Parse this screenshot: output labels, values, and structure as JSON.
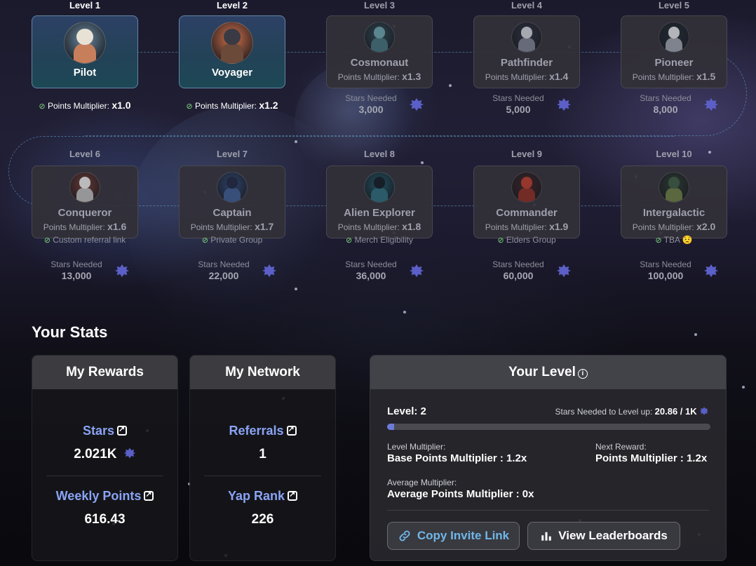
{
  "levels": [
    {
      "level_label": "Level 1",
      "name": "Pilot",
      "multiplier_label": "Points Multiplier:",
      "multiplier_value": "x1.0",
      "unlocked": true,
      "palette": {
        "bg": "#6b8aa0",
        "helmet": "#e8e2d6",
        "body": "#c77f5b"
      }
    },
    {
      "level_label": "Level 2",
      "name": "Voyager",
      "multiplier_label": "Points Multiplier:",
      "multiplier_value": "x1.2",
      "unlocked": true,
      "palette": {
        "bg": "#d7724a",
        "helmet": "#3a3a44",
        "body": "#6b4a3a"
      }
    },
    {
      "level_label": "Level 3",
      "name": "Cosmonaut",
      "multiplier_label": "Points Multiplier:",
      "multiplier_value": "x1.3",
      "unlocked": false,
      "stars_label": "Stars Needed",
      "stars_value": "3,000",
      "palette": {
        "bg": "#2a4a55",
        "helmet": "#6aa2ad",
        "body": "#40707a"
      }
    },
    {
      "level_label": "Level 4",
      "name": "Pathfinder",
      "multiplier_label": "Points Multiplier:",
      "multiplier_value": "x1.4",
      "unlocked": false,
      "stars_label": "Stars Needed",
      "stars_value": "5,000",
      "palette": {
        "bg": "#2a3240",
        "helmet": "#cfd3da",
        "body": "#7a8090"
      }
    },
    {
      "level_label": "Level 5",
      "name": "Pioneer",
      "multiplier_label": "Points Multiplier:",
      "multiplier_value": "x1.5",
      "unlocked": false,
      "stars_label": "Stars Needed",
      "stars_value": "8,000",
      "palette": {
        "bg": "#1e2a34",
        "helmet": "#e0e2e6",
        "body": "#9aa0aa"
      }
    },
    {
      "level_label": "Level 6",
      "name": "Conqueror",
      "multiplier_label": "Points Multiplier:",
      "multiplier_value": "x1.6",
      "perk": "Custom referral link",
      "unlocked": false,
      "stars_label": "Stars Needed",
      "stars_value": "13,000",
      "palette": {
        "bg": "#7a3a30",
        "helmet": "#e8e8e8",
        "body": "#b8b8b8"
      }
    },
    {
      "level_label": "Level 7",
      "name": "Captain",
      "multiplier_label": "Points Multiplier:",
      "multiplier_value": "x1.7",
      "perk": "Private Group",
      "unlocked": false,
      "stars_label": "Stars Needed",
      "stars_value": "22,000",
      "palette": {
        "bg": "#2c4a7a",
        "helmet": "#1a2440",
        "body": "#3a5a90"
      }
    },
    {
      "level_label": "Level 8",
      "name": "Alien Explorer",
      "multiplier_label": "Points Multiplier:",
      "multiplier_value": "x1.8",
      "perk": "Merch Eligibility",
      "unlocked": false,
      "stars_label": "Stars Needed",
      "stars_value": "36,000",
      "palette": {
        "bg": "#1a5a6a",
        "helmet": "#0e1a22",
        "body": "#2a6a7a"
      }
    },
    {
      "level_label": "Level 9",
      "name": "Commander",
      "multiplier_label": "Points Multiplier:",
      "multiplier_value": "x1.9",
      "perk": "Elders Group",
      "unlocked": false,
      "stars_label": "Stars Needed",
      "stars_value": "60,000",
      "palette": {
        "bg": "#3a2020",
        "helmet": "#b83a2a",
        "body": "#8a2a20"
      }
    },
    {
      "level_label": "Level 10",
      "name": "Intergalactic",
      "multiplier_label": "Points Multiplier:",
      "multiplier_value": "x2.0",
      "perk": "TBA",
      "perk_emoji": "😟",
      "unlocked": false,
      "stars_label": "Stars Needed",
      "stars_value": "100,000",
      "palette": {
        "bg": "#2a3a30",
        "helmet": "#3a5a40",
        "body": "#6a7a40"
      }
    }
  ],
  "stats": {
    "title": "Your Stats",
    "rewards": {
      "title": "My Rewards",
      "stars_label": "Stars",
      "stars_value": "2.021K",
      "weekly_label": "Weekly Points",
      "weekly_value": "616.43"
    },
    "network": {
      "title": "My Network",
      "referrals_label": "Referrals",
      "referrals_value": "1",
      "yap_label": "Yap Rank",
      "yap_value": "226"
    },
    "your_level": {
      "title": "Your Level",
      "level_text": "Level: 2",
      "stars_to_level_label": "Stars Needed to Level up:",
      "stars_to_level_value": "20.86 / 1K",
      "progress_fraction": 0.021,
      "level_multiplier_label": "Level Multiplier:",
      "level_multiplier_value": "Base Points Multiplier : 1.2x",
      "next_reward_label": "Next Reward:",
      "next_reward_value": "Points Multiplier : 1.2x",
      "avg_multiplier_label": "Average Multiplier:",
      "avg_multiplier_value": "Average Points Multiplier : 0x",
      "copy_button": "Copy Invite Link",
      "leaderboard_button": "View Leaderboards"
    }
  },
  "colors": {
    "accent_blue": "#8aa3f5",
    "star_badge": "#5b5fc7",
    "check_green": "#7fd67f",
    "copy_text": "#6fb8e8"
  }
}
